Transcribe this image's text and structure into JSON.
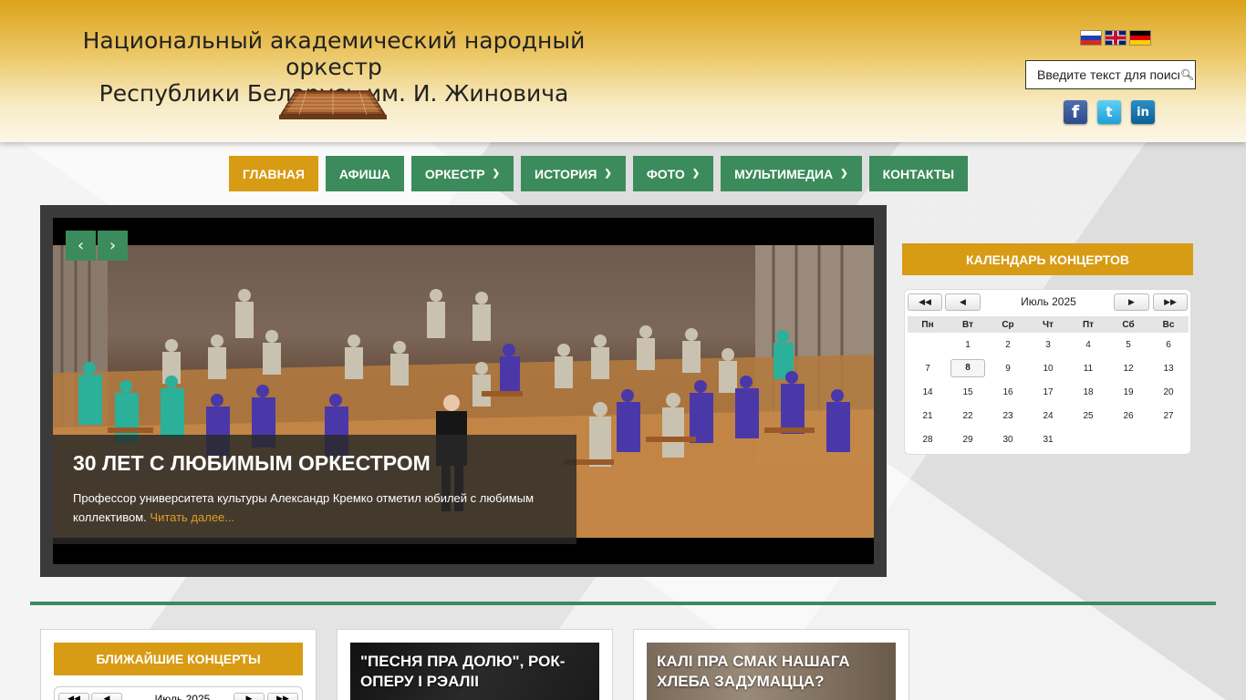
{
  "header": {
    "title_line1": "Национальный академический народный оркестр",
    "title_line2": "Республики Беларусь им. И. Жиновича",
    "search_placeholder": "Введите текст для поиска...",
    "languages": [
      "ru",
      "en",
      "de"
    ],
    "social": [
      {
        "name": "facebook",
        "glyph": "f"
      },
      {
        "name": "twitter",
        "glyph": "t"
      },
      {
        "name": "linkedin",
        "glyph": "in"
      }
    ]
  },
  "nav": {
    "items": [
      {
        "label": "Главная",
        "active": true,
        "dropdown": false
      },
      {
        "label": "Афиша",
        "active": false,
        "dropdown": false
      },
      {
        "label": "Оркестр",
        "active": false,
        "dropdown": true
      },
      {
        "label": "История",
        "active": false,
        "dropdown": true
      },
      {
        "label": "Фото",
        "active": false,
        "dropdown": true
      },
      {
        "label": "Мультимедиа",
        "active": false,
        "dropdown": true
      },
      {
        "label": "Контакты",
        "active": false,
        "dropdown": false
      }
    ]
  },
  "slider": {
    "prev_glyph": "‹",
    "next_glyph": "›",
    "title": "30 ЛЕТ С ЛЮБИМЫМ ОРКЕСТРОМ",
    "text": "Профессор университета культуры Александр Кремко отметил юбилей с любимым коллективом.",
    "read_more": "Читать далее..."
  },
  "calendar": {
    "header": "КАЛЕНДАРЬ КОНЦЕРТОВ",
    "month": "Июль 2025",
    "prev_year": "◀◀",
    "prev_month": "◀",
    "next_month": "▶",
    "next_year": "▶▶",
    "weekdays": [
      "Пн",
      "Вт",
      "Ср",
      "Чт",
      "Пт",
      "Сб",
      "Вс"
    ],
    "weeks": [
      [
        "",
        "1",
        "2",
        "3",
        "4",
        "5",
        "6"
      ],
      [
        "7",
        "8",
        "9",
        "10",
        "11",
        "12",
        "13"
      ],
      [
        "14",
        "15",
        "16",
        "17",
        "18",
        "19",
        "20"
      ],
      [
        "21",
        "22",
        "23",
        "24",
        "25",
        "26",
        "27"
      ],
      [
        "28",
        "29",
        "30",
        "31",
        "",
        "",
        ""
      ]
    ],
    "today": "8"
  },
  "bottom": {
    "near_header": "БЛИЖАЙШИЕ КОНЦЕРТЫ",
    "near_month": "Июль 2025",
    "news": [
      {
        "title": "\"ПЕСНЯ ПРА ДОЛЮ\", РОК-ОПЕРУ І РЭАЛІІ"
      },
      {
        "title": "КАЛІ ПРА СМАК НАШАГА ХЛЕБА ЗАДУМАЦЦА?"
      }
    ]
  },
  "colors": {
    "accent_green": "#3c8b5c",
    "accent_gold": "#d89b14"
  }
}
